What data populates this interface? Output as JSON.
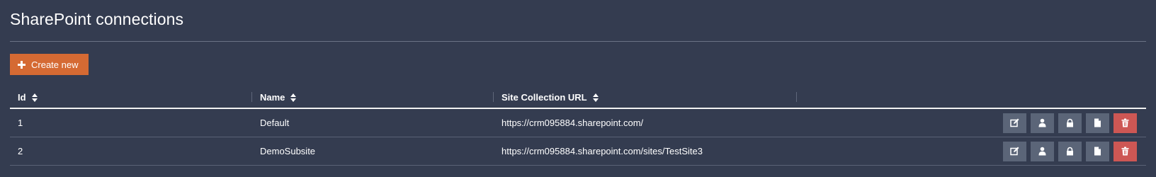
{
  "page": {
    "title": "SharePoint connections"
  },
  "toolbar": {
    "create_label": "Create new"
  },
  "table": {
    "columns": [
      "Id",
      "Name",
      "Site Collection URL"
    ],
    "rows": [
      {
        "id": "1",
        "name": "Default",
        "url": "https://crm095884.sharepoint.com/"
      },
      {
        "id": "2",
        "name": "DemoSubsite",
        "url": "https://crm095884.sharepoint.com/sites/TestSite3"
      }
    ],
    "row_actions": [
      "edit-icon",
      "user-icon",
      "lock-icon",
      "document-icon",
      "trash-icon"
    ]
  },
  "colors": {
    "background": "#343c50",
    "accent": "#d56a33",
    "action_button": "#5b6578",
    "danger": "#cd5754"
  }
}
